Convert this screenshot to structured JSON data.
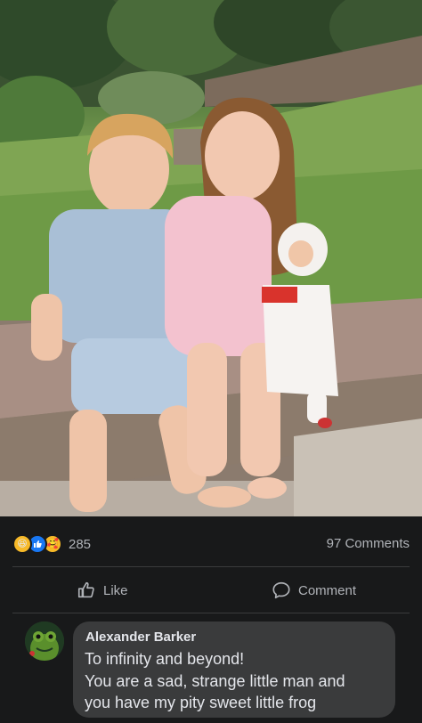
{
  "photo": {
    "description_icon": "photo-of-two-children-with-doll"
  },
  "stats": {
    "reaction_icons": [
      "haha-icon",
      "like-icon",
      "care-icon"
    ],
    "reaction_count": "285",
    "comments_count": "97 Comments"
  },
  "actions": {
    "like_label": "Like",
    "comment_label": "Comment"
  },
  "comment": {
    "author": "Alexander Barker",
    "lines": [
      "To infinity and beyond!",
      "You are a sad, strange little man and",
      "you have my pity sweet little frog"
    ]
  },
  "colors": {
    "background": "#18191a",
    "bubble": "#3a3b3c",
    "text": "#e4e6eb",
    "muted": "#b0b3b8",
    "like_blue": "#1877f2"
  }
}
